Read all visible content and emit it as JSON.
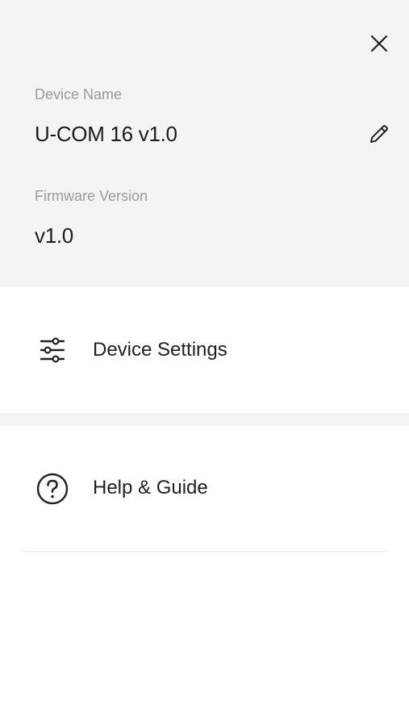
{
  "header": {
    "close_icon": "close-icon"
  },
  "device": {
    "name_label": "Device Name",
    "name_value": "U-COM 16 v1.0",
    "edit_icon": "pencil-icon",
    "firmware_label": "Firmware Version",
    "firmware_value": "v1.0"
  },
  "menu": {
    "items": [
      {
        "label": "Device Settings",
        "icon": "sliders-icon"
      },
      {
        "label": "Help & Guide",
        "icon": "help-circle-icon"
      }
    ]
  },
  "colors": {
    "panel_background": "#f4f4f4",
    "label_gray": "#9a9a9a",
    "text_dark": "#1c1c1c"
  }
}
